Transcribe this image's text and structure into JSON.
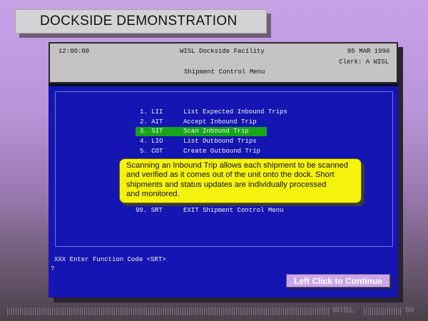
{
  "slide": {
    "title": "DOCKSIDE DEMONSTRATION",
    "continue_label": "Left Click to Continue",
    "footer_text": "WISL",
    "page_number": "59"
  },
  "terminal": {
    "header": {
      "time": "12:00:00",
      "facility": "WISL Dockside Facility",
      "date": "05 MAR 1996",
      "clerk": "Clerk: A WISL",
      "menu_title": "Shipment Control Menu"
    },
    "menu": [
      {
        "code": "1. LII",
        "label": "List Expected Inbound Trips",
        "selected": false
      },
      {
        "code": "2. AIT",
        "label": "Accept Inbound Trip",
        "selected": false
      },
      {
        "code": "3. SIT",
        "label": "Scan Inbound Trip",
        "selected": true
      },
      {
        "code": "4. LIO",
        "label": "List Outbound Trips",
        "selected": false
      },
      {
        "code": "5. COT",
        "label": "Create Outbound Trip",
        "selected": false
      }
    ],
    "exit_item": {
      "code": "99. SRT",
      "label": "EXIT Shipment Control Menu"
    },
    "prompt": "XXX Enter Function Code <SRT>",
    "cursor": "?"
  },
  "callout": {
    "lines": [
      "Scanning an Inbound Trip allows each shipment to be scanned",
      "and verified as it comes out of the unit onto the dock. Short",
      "shipments and status updates are individually processed",
      "and monitored."
    ]
  },
  "colors": {
    "terminal_blue": "#1515b3",
    "selection_green": "#17a51a",
    "callout_yellow": "#f5f20e",
    "button_lavender": "#c9a7ea"
  }
}
